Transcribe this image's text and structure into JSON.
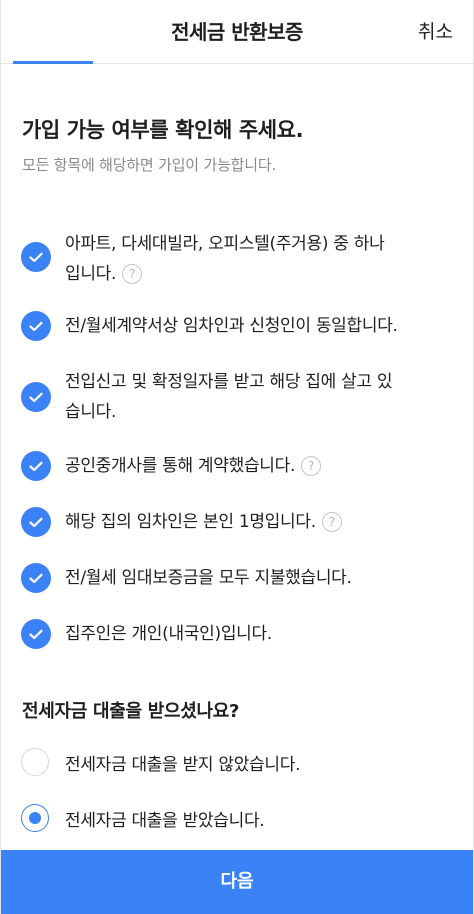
{
  "header": {
    "title": "전세금 반환보증",
    "cancel_label": "취소"
  },
  "intro": {
    "heading": "가입 가능 여부를 확인해 주세요.",
    "subheading": "모든 항목에 해당하면 가입이 가능합니다."
  },
  "conditions": [
    {
      "text": "아파트, 다세대빌라, 오피스텔(주거용) 중 하나입니다.",
      "checked": true,
      "help": true
    },
    {
      "text": "전/월세계약서상 임차인과 신청인이 동일합니다.",
      "checked": true,
      "help": false
    },
    {
      "text": "전입신고 및 확정일자를 받고 해당 집에 살고 있습니다.",
      "checked": true,
      "help": false
    },
    {
      "text": "공인중개사를 통해 계약했습니다.",
      "checked": true,
      "help": true
    },
    {
      "text": "해당 집의 임차인은 본인 1명입니다.",
      "checked": true,
      "help": true
    },
    {
      "text": "전/월세 임대보증금을 모두 지불했습니다.",
      "checked": true,
      "help": false
    },
    {
      "text": "집주인은 개인(내국인)입니다.",
      "checked": true,
      "help": false
    }
  ],
  "help_glyph": "?",
  "loan": {
    "question": "전세자금 대출을 받으셨나요?",
    "options": [
      {
        "label": "전세자금 대출을 받지 않았습니다.",
        "selected": false
      },
      {
        "label": "전세자금 대출을 받았습니다.",
        "selected": true
      }
    ]
  },
  "footer": {
    "next_label": "다음"
  },
  "colors": {
    "accent": "#3b82f6",
    "muted_text": "#8a8a8a"
  }
}
